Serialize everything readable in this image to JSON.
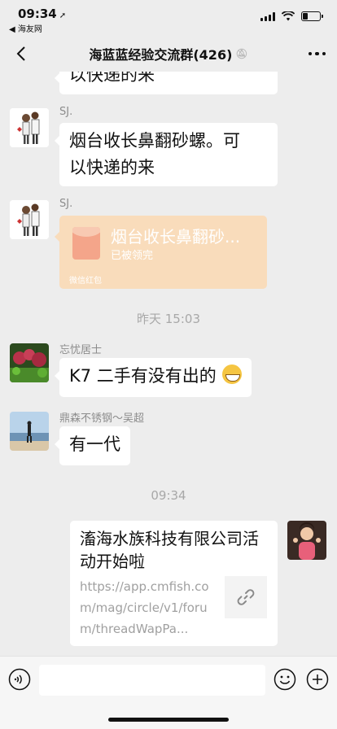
{
  "status_bar": {
    "time": "09:34",
    "back_app": "◀ 海友网",
    "battery_level": 0.3
  },
  "nav": {
    "title": "海蓝蓝经验交流群(426)"
  },
  "messages": [
    {
      "bubble": "以快递的来"
    },
    {
      "sender": "SJ.",
      "bubble_line1": "烟台收长鼻翻砂螺。可",
      "bubble_line2": "以快递的来"
    },
    {
      "sender": "SJ.",
      "red_packet": {
        "title": "烟台收长鼻翻砂...",
        "status": "已被领完",
        "footer": "微信红包"
      }
    },
    {
      "time": "昨天 15:03"
    },
    {
      "sender": "忘忧居士",
      "bubble": "K7 二手有没有出的"
    },
    {
      "sender": "鼎森不锈钢～吴超",
      "bubble": "有一代"
    },
    {
      "time": "09:34"
    },
    {
      "link_card": {
        "title": "滀海水族科技有限公司活动开始啦",
        "url": "https://app.cmfish.com/mag/circle/v1/forum/threadWapPa..."
      }
    }
  ],
  "colors": {
    "background": "#ededed",
    "bubble": "#ffffff",
    "red_packet": "#f9dcbb"
  }
}
